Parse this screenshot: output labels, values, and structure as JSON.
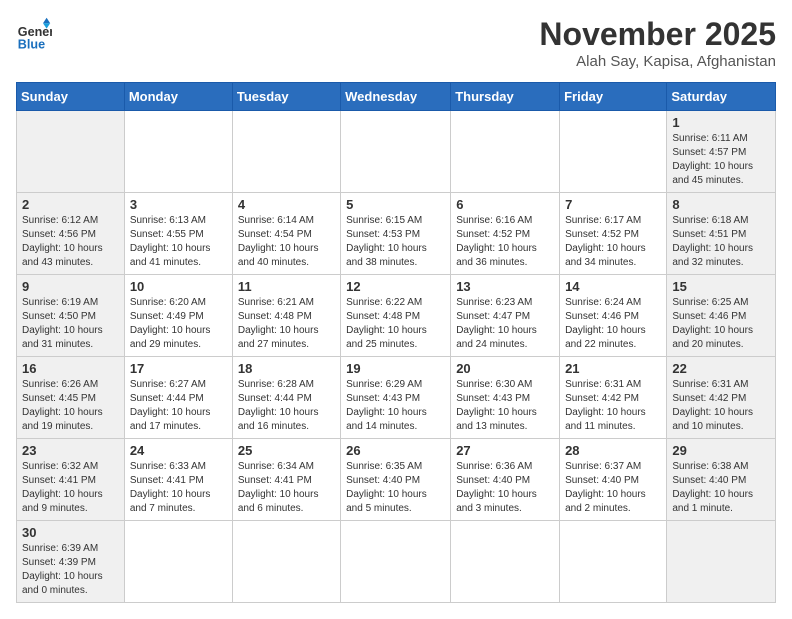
{
  "logo": {
    "line1": "General",
    "line2": "Blue"
  },
  "header": {
    "month": "November 2025",
    "location": "Alah Say, Kapisa, Afghanistan"
  },
  "weekdays": [
    "Sunday",
    "Monday",
    "Tuesday",
    "Wednesday",
    "Thursday",
    "Friday",
    "Saturday"
  ],
  "weeks": [
    [
      {
        "day": "",
        "info": ""
      },
      {
        "day": "",
        "info": ""
      },
      {
        "day": "",
        "info": ""
      },
      {
        "day": "",
        "info": ""
      },
      {
        "day": "",
        "info": ""
      },
      {
        "day": "",
        "info": ""
      },
      {
        "day": "1",
        "info": "Sunrise: 6:11 AM\nSunset: 4:57 PM\nDaylight: 10 hours and 45 minutes."
      }
    ],
    [
      {
        "day": "2",
        "info": "Sunrise: 6:12 AM\nSunset: 4:56 PM\nDaylight: 10 hours and 43 minutes."
      },
      {
        "day": "3",
        "info": "Sunrise: 6:13 AM\nSunset: 4:55 PM\nDaylight: 10 hours and 41 minutes."
      },
      {
        "day": "4",
        "info": "Sunrise: 6:14 AM\nSunset: 4:54 PM\nDaylight: 10 hours and 40 minutes."
      },
      {
        "day": "5",
        "info": "Sunrise: 6:15 AM\nSunset: 4:53 PM\nDaylight: 10 hours and 38 minutes."
      },
      {
        "day": "6",
        "info": "Sunrise: 6:16 AM\nSunset: 4:52 PM\nDaylight: 10 hours and 36 minutes."
      },
      {
        "day": "7",
        "info": "Sunrise: 6:17 AM\nSunset: 4:52 PM\nDaylight: 10 hours and 34 minutes."
      },
      {
        "day": "8",
        "info": "Sunrise: 6:18 AM\nSunset: 4:51 PM\nDaylight: 10 hours and 32 minutes."
      }
    ],
    [
      {
        "day": "9",
        "info": "Sunrise: 6:19 AM\nSunset: 4:50 PM\nDaylight: 10 hours and 31 minutes."
      },
      {
        "day": "10",
        "info": "Sunrise: 6:20 AM\nSunset: 4:49 PM\nDaylight: 10 hours and 29 minutes."
      },
      {
        "day": "11",
        "info": "Sunrise: 6:21 AM\nSunset: 4:48 PM\nDaylight: 10 hours and 27 minutes."
      },
      {
        "day": "12",
        "info": "Sunrise: 6:22 AM\nSunset: 4:48 PM\nDaylight: 10 hours and 25 minutes."
      },
      {
        "day": "13",
        "info": "Sunrise: 6:23 AM\nSunset: 4:47 PM\nDaylight: 10 hours and 24 minutes."
      },
      {
        "day": "14",
        "info": "Sunrise: 6:24 AM\nSunset: 4:46 PM\nDaylight: 10 hours and 22 minutes."
      },
      {
        "day": "15",
        "info": "Sunrise: 6:25 AM\nSunset: 4:46 PM\nDaylight: 10 hours and 20 minutes."
      }
    ],
    [
      {
        "day": "16",
        "info": "Sunrise: 6:26 AM\nSunset: 4:45 PM\nDaylight: 10 hours and 19 minutes."
      },
      {
        "day": "17",
        "info": "Sunrise: 6:27 AM\nSunset: 4:44 PM\nDaylight: 10 hours and 17 minutes."
      },
      {
        "day": "18",
        "info": "Sunrise: 6:28 AM\nSunset: 4:44 PM\nDaylight: 10 hours and 16 minutes."
      },
      {
        "day": "19",
        "info": "Sunrise: 6:29 AM\nSunset: 4:43 PM\nDaylight: 10 hours and 14 minutes."
      },
      {
        "day": "20",
        "info": "Sunrise: 6:30 AM\nSunset: 4:43 PM\nDaylight: 10 hours and 13 minutes."
      },
      {
        "day": "21",
        "info": "Sunrise: 6:31 AM\nSunset: 4:42 PM\nDaylight: 10 hours and 11 minutes."
      },
      {
        "day": "22",
        "info": "Sunrise: 6:31 AM\nSunset: 4:42 PM\nDaylight: 10 hours and 10 minutes."
      }
    ],
    [
      {
        "day": "23",
        "info": "Sunrise: 6:32 AM\nSunset: 4:41 PM\nDaylight: 10 hours and 9 minutes."
      },
      {
        "day": "24",
        "info": "Sunrise: 6:33 AM\nSunset: 4:41 PM\nDaylight: 10 hours and 7 minutes."
      },
      {
        "day": "25",
        "info": "Sunrise: 6:34 AM\nSunset: 4:41 PM\nDaylight: 10 hours and 6 minutes."
      },
      {
        "day": "26",
        "info": "Sunrise: 6:35 AM\nSunset: 4:40 PM\nDaylight: 10 hours and 5 minutes."
      },
      {
        "day": "27",
        "info": "Sunrise: 6:36 AM\nSunset: 4:40 PM\nDaylight: 10 hours and 3 minutes."
      },
      {
        "day": "28",
        "info": "Sunrise: 6:37 AM\nSunset: 4:40 PM\nDaylight: 10 hours and 2 minutes."
      },
      {
        "day": "29",
        "info": "Sunrise: 6:38 AM\nSunset: 4:40 PM\nDaylight: 10 hours and 1 minute."
      }
    ],
    [
      {
        "day": "30",
        "info": "Sunrise: 6:39 AM\nSunset: 4:39 PM\nDaylight: 10 hours and 0 minutes."
      },
      {
        "day": "",
        "info": ""
      },
      {
        "day": "",
        "info": ""
      },
      {
        "day": "",
        "info": ""
      },
      {
        "day": "",
        "info": ""
      },
      {
        "day": "",
        "info": ""
      },
      {
        "day": "",
        "info": ""
      }
    ]
  ]
}
